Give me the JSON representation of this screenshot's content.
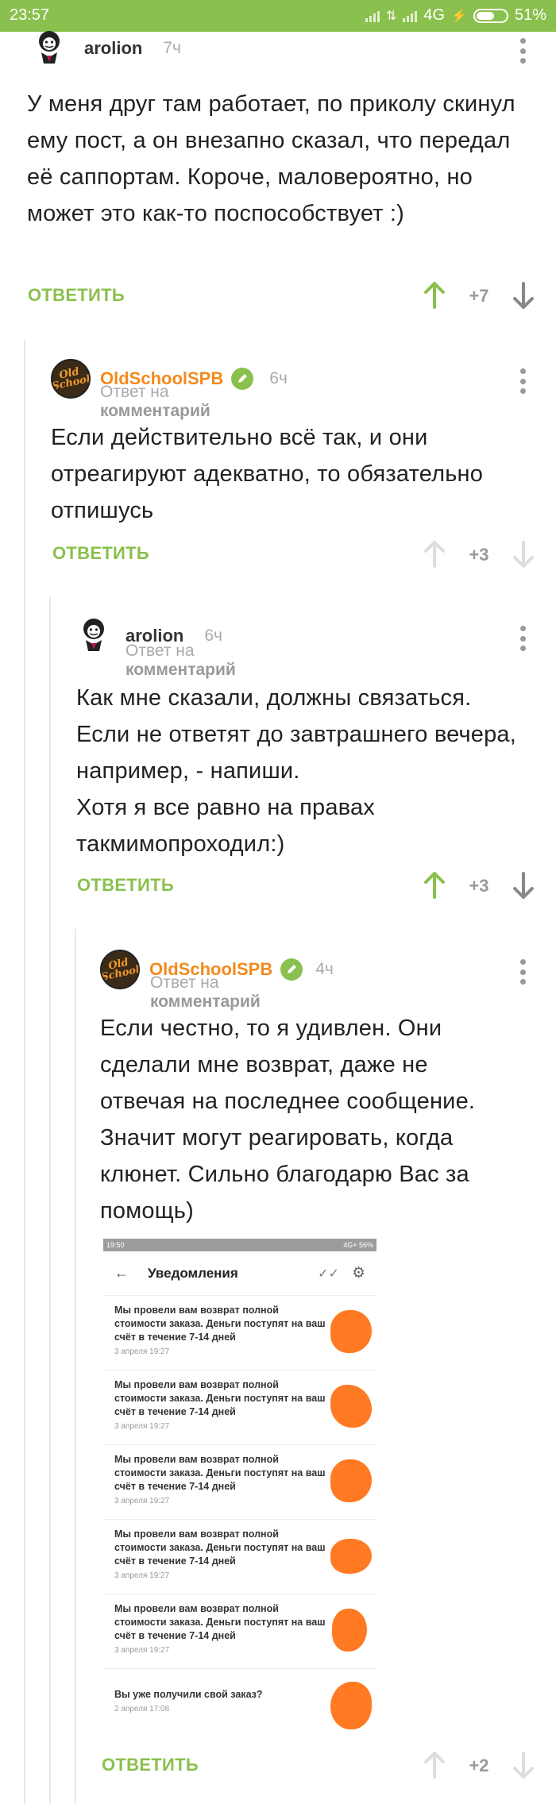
{
  "status_bar": {
    "time": "23:57",
    "network": "4G",
    "battery": "51%"
  },
  "comments": [
    {
      "author": "arolion",
      "time": "7ч",
      "text": "У меня друг там работает, по приколу скинул ему пост, а он внезапно сказал, что передал её саппортам. Короче, маловероятно, но может это как-то поспособствует :)",
      "reply_label": "ОТВЕТИТЬ",
      "rating": "+7"
    },
    {
      "author": "OldSchoolSPB",
      "time": "6ч",
      "reply_prefix": "Ответ на",
      "reply_target": "комментарий",
      "text": "Если действительно всё так, и они отреагируют адекватно, то обязательно отпишусь",
      "reply_label": "ОТВЕТИТЬ",
      "rating": "+3"
    },
    {
      "author": "arolion",
      "time": "6ч",
      "reply_prefix": "Ответ на",
      "reply_target": "комментарий",
      "text": "Как мне сказали, должны связаться.\nЕсли не ответят до завтрашнего вечера,  например, - напиши.\nХотя я все равно на правах такмимопроходил:)",
      "reply_label": "ОТВЕТИТЬ",
      "rating": "+3"
    },
    {
      "author": "OldSchoolSPB",
      "time": "4ч",
      "reply_prefix": "Ответ на",
      "reply_target": "комментарий",
      "text": "Если честно, то я удивлен. Они сделали мне возврат, даже не отвечая на последнее сообщение. Значит могут реагировать, когда клюнет. Сильно благодарю Вас за помощь)",
      "reply_label": "ОТВЕТИТЬ",
      "rating": "+2"
    }
  ],
  "avatar_text": "Old School",
  "screenshot": {
    "status_time": "19:50",
    "status_right": "4G+ 56%",
    "title": "Уведомления",
    "items": [
      {
        "msg": "Мы провели вам возврат полной стоимости заказа. Деньги поступят на ваш счёт в течение 7-14 дней",
        "date": "3 апреля 19:27"
      },
      {
        "msg": "Мы провели вам возврат полной стоимости заказа. Деньги поступят на ваш счёт в течение 7-14 дней",
        "date": "3 апреля 19:27"
      },
      {
        "msg": "Мы провели вам возврат полной стоимости заказа. Деньги поступят на ваш счёт в течение 7-14 дней",
        "date": "3 апреля 19:27"
      },
      {
        "msg": "Мы провели вам возврат полной стоимости заказа. Деньги поступят на ваш счёт в течение 7-14 дней",
        "date": "3 апреля 19:27"
      },
      {
        "msg": "Мы провели вам возврат полной стоимости заказа. Деньги поступят на ваш счёт в течение 7-14 дней",
        "date": "3 апреля 19:27"
      },
      {
        "msg": "Вы уже получили свой заказ?",
        "date": "2 апреля 17:08"
      }
    ]
  },
  "colors": {
    "accent_green": "#8ac04d",
    "author_orange": "#f28a1e",
    "censor_orange": "#ff7a22"
  }
}
